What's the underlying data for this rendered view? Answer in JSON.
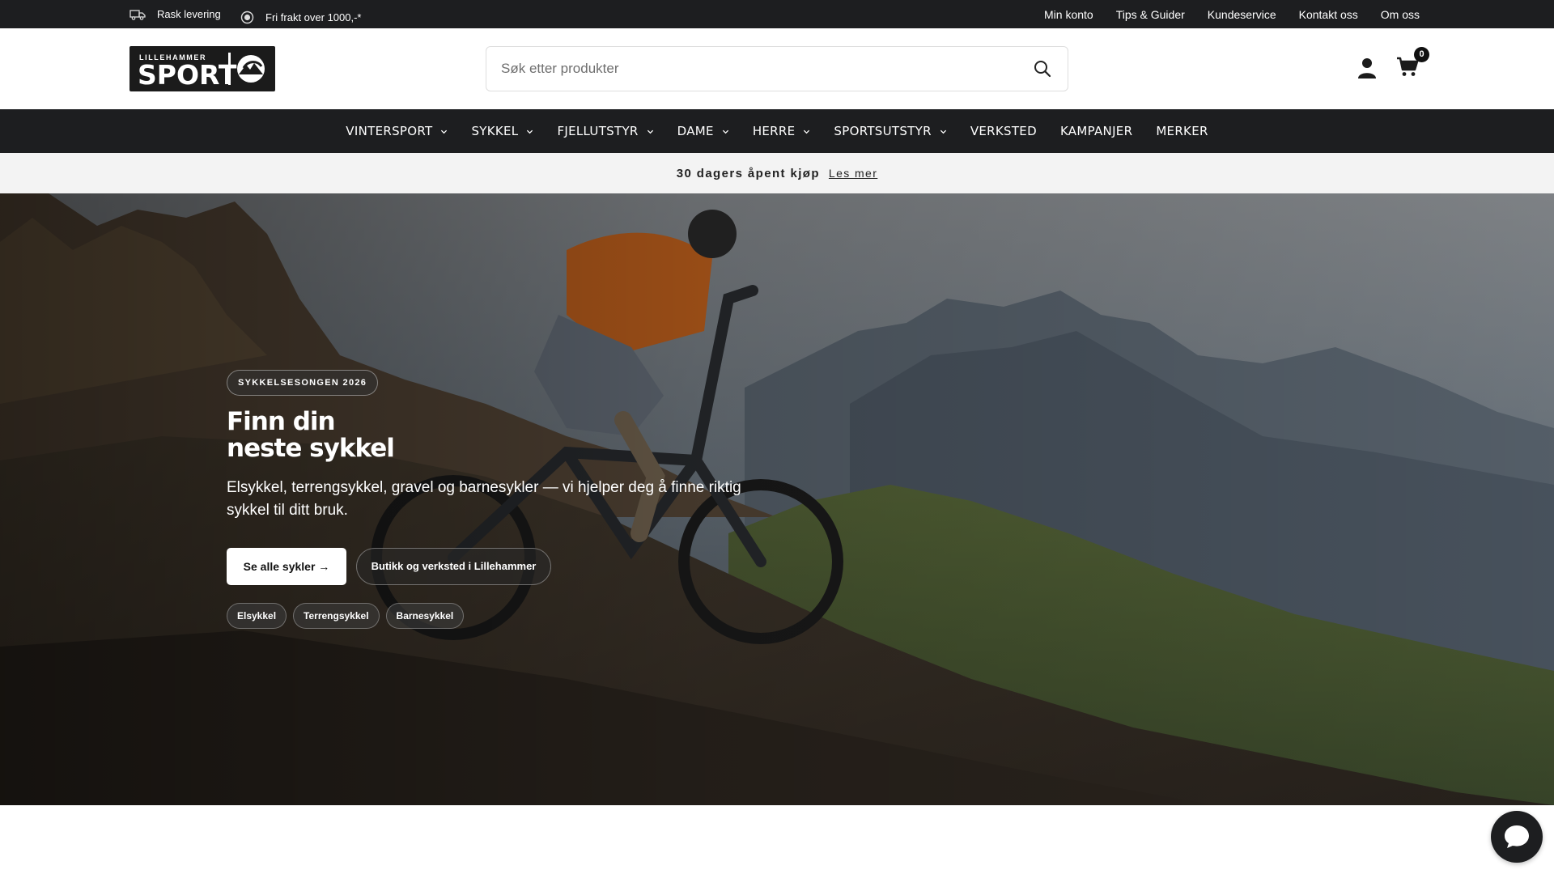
{
  "topbar": {
    "usps": [
      {
        "icon": "truck-icon",
        "label": "Rask levering"
      },
      {
        "icon": "badge-icon",
        "label": "Fri frakt over 1000,-*"
      }
    ],
    "links": [
      "Min konto",
      "Tips & Guider",
      "Kundeservice",
      "Kontakt oss",
      "Om oss"
    ]
  },
  "header": {
    "logo_small": "LILLEHAMMER",
    "logo_big": "SPORT",
    "search_placeholder": "Søk etter produkter",
    "cart_count": "0"
  },
  "nav": {
    "items": [
      {
        "label": "VINTERSPORT",
        "dropdown": true
      },
      {
        "label": "SYKKEL",
        "dropdown": true
      },
      {
        "label": "FJELLUTSTYR",
        "dropdown": true
      },
      {
        "label": "DAME",
        "dropdown": true
      },
      {
        "label": "HERRE",
        "dropdown": true
      },
      {
        "label": "SPORTSUTSTYR",
        "dropdown": true
      },
      {
        "label": "VERKSTED",
        "dropdown": false
      },
      {
        "label": "KAMPANJER",
        "dropdown": false
      },
      {
        "label": "MERKER",
        "dropdown": false
      }
    ]
  },
  "announcement": {
    "text": "30 dagers åpent kjøp",
    "link": "Les mer"
  },
  "hero": {
    "badge": "SYKKELSESONGEN 2026",
    "title_line1": "Finn din",
    "title_line2": "neste sykkel",
    "lead": "Elsykkel, terrengsykkel, gravel og barnesykler — vi hjelper deg å finne riktig sykkel til ditt bruk.",
    "primary_button": "Se alle sykler →",
    "secondary_button": "Butikk og verksted i Lillehammer",
    "chips": [
      "Elsykkel",
      "Terrengsykkel",
      "Barnesykkel"
    ]
  },
  "colors": {
    "dark_bar": "#1d1e20",
    "announce_bg": "#f3f3f3",
    "white": "#ffffff"
  },
  "chat": {
    "icon": "chat-bubble-icon"
  }
}
